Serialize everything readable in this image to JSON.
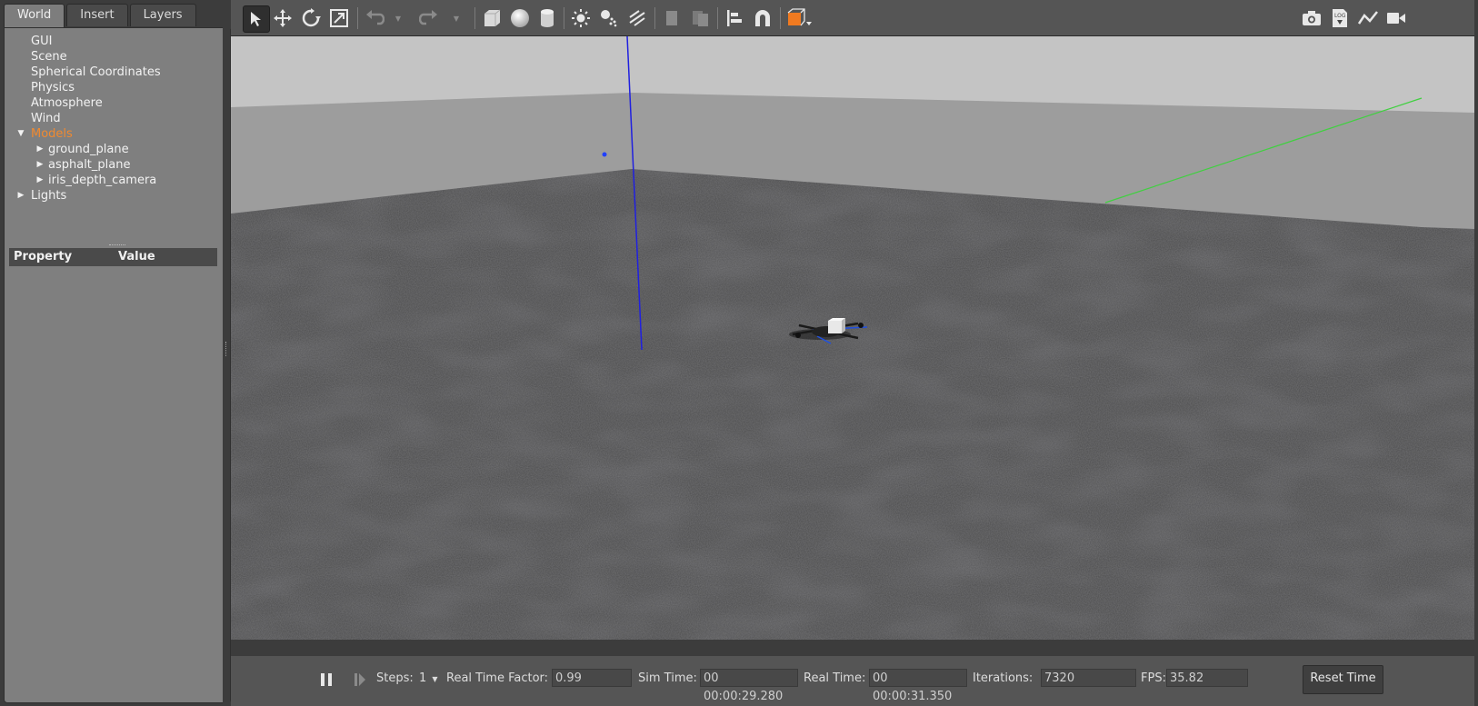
{
  "left_panel": {
    "tabs": [
      {
        "label": "World",
        "active": true
      },
      {
        "label": "Insert",
        "active": false
      },
      {
        "label": "Layers",
        "active": false
      }
    ],
    "tree": [
      {
        "label": "GUI",
        "level": 0,
        "expander": "none"
      },
      {
        "label": "Scene",
        "level": 0,
        "expander": "none"
      },
      {
        "label": "Spherical Coordinates",
        "level": 0,
        "expander": "none"
      },
      {
        "label": "Physics",
        "level": 0,
        "expander": "none"
      },
      {
        "label": "Atmosphere",
        "level": 0,
        "expander": "none"
      },
      {
        "label": "Wind",
        "level": 0,
        "expander": "none"
      },
      {
        "label": "Models",
        "level": 0,
        "expander": "expanded",
        "highlight": true
      },
      {
        "label": "ground_plane",
        "level": 1,
        "expander": "collapsed"
      },
      {
        "label": "asphalt_plane",
        "level": 1,
        "expander": "collapsed"
      },
      {
        "label": "iris_depth_camera",
        "level": 1,
        "expander": "collapsed"
      },
      {
        "label": "Lights",
        "level": 0,
        "expander": "collapsed"
      }
    ],
    "property_table": {
      "col_property": "Property",
      "col_value": "Value"
    }
  },
  "toolbar": {
    "tools": [
      {
        "icon": "select-arrow-icon",
        "active": true
      },
      {
        "icon": "translate-icon"
      },
      {
        "icon": "rotate-icon"
      },
      {
        "icon": "scale-icon"
      },
      {
        "icon": "undo-icon",
        "disabled": true
      },
      {
        "icon": "undo-history-icon",
        "disabled": true
      },
      {
        "icon": "redo-icon",
        "disabled": true
      },
      {
        "icon": "redo-history-icon",
        "disabled": true
      },
      {
        "icon": "box-shape-icon"
      },
      {
        "icon": "sphere-shape-icon"
      },
      {
        "icon": "cylinder-shape-icon"
      },
      {
        "icon": "point-light-icon"
      },
      {
        "icon": "spot-light-icon"
      },
      {
        "icon": "directional-light-icon"
      },
      {
        "icon": "copy-icon",
        "disabled": true
      },
      {
        "icon": "paste-icon",
        "disabled": true
      },
      {
        "icon": "align-icon"
      },
      {
        "icon": "snap-magnet-icon"
      },
      {
        "icon": "view-angle-icon"
      },
      {
        "icon": "screenshot-icon"
      },
      {
        "icon": "log-icon"
      },
      {
        "icon": "plot-icon"
      },
      {
        "icon": "video-record-icon"
      }
    ],
    "accent_color": "#f07a20"
  },
  "statusbar": {
    "steps_label": "Steps:",
    "steps_value": "1",
    "rtf_label": "Real Time Factor:",
    "rtf_value": "0.99",
    "sim_time_label": "Sim Time:",
    "sim_time_value": "00 00:00:29.280",
    "real_time_label": "Real Time:",
    "real_time_value": "00 00:00:31.350",
    "iterations_label": "Iterations:",
    "iterations_value": "7320",
    "fps_label": "FPS:",
    "fps_value": "35.82",
    "reset_label": "Reset Time"
  }
}
